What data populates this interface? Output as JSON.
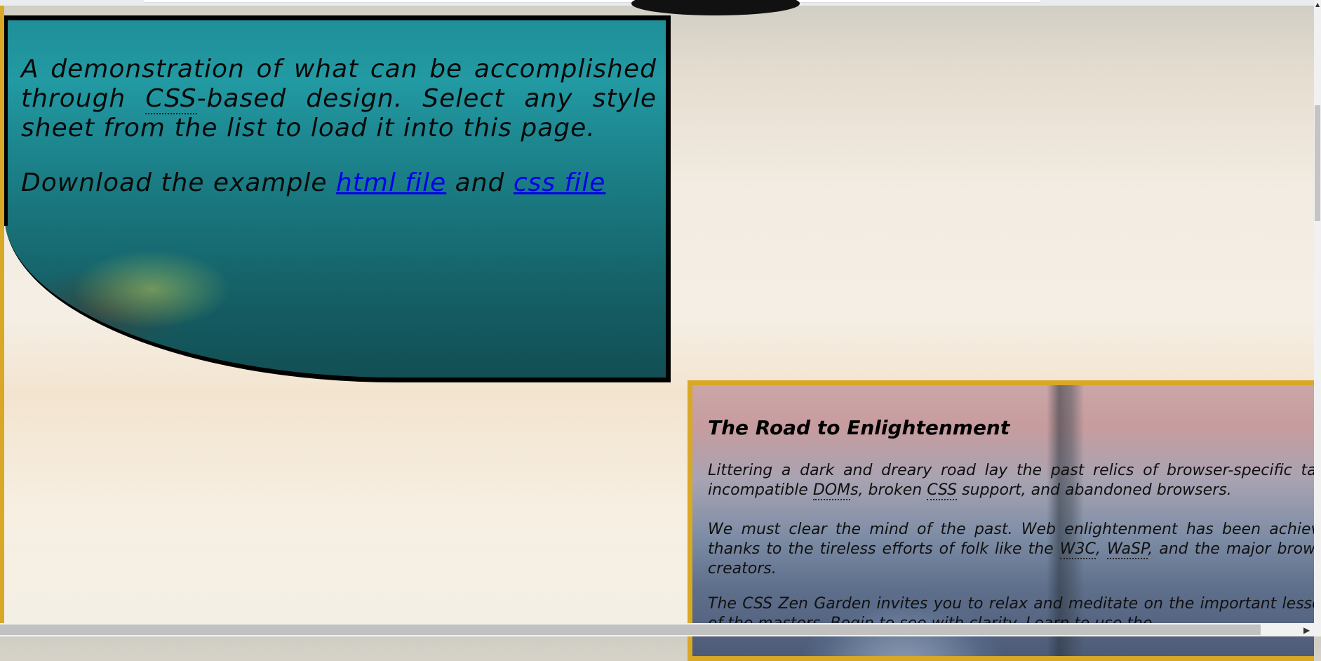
{
  "intro": {
    "p1": {
      "pre": "A demonstration of what can be accomplished through ",
      "abbr": "CSS",
      "post": "-based design. Select any style sheet from the list to load it into this page."
    },
    "p2": {
      "pre": "Download the example ",
      "link1": "html file",
      "mid": " and ",
      "link2": "css file"
    }
  },
  "road": {
    "title": "The Road to Enlightenment",
    "p1": {
      "text1": "Littering a dark and dreary road lay the past relics of browser-specific tags, incompatible ",
      "abbr1": "DOM",
      "text2": "s, broken ",
      "abbr2": "CSS",
      "text3": " support, and abandoned browsers."
    },
    "p2": {
      "text1": "We must clear the mind of the past. Web enlightenment has been achieved thanks to the tireless efforts of folk like the ",
      "abbr1": "W3C",
      "text2": ", ",
      "abbr2": "WaSP",
      "text3": ", and the major browser creators."
    },
    "p3": {
      "text1": "The CSS Zen Garden invites you to relax and meditate on the important lessons of the masters. Begin to see with clarity. Learn to use the"
    }
  },
  "scrollbars": {
    "up_arrow": "▲",
    "right_arrow": "▶"
  }
}
